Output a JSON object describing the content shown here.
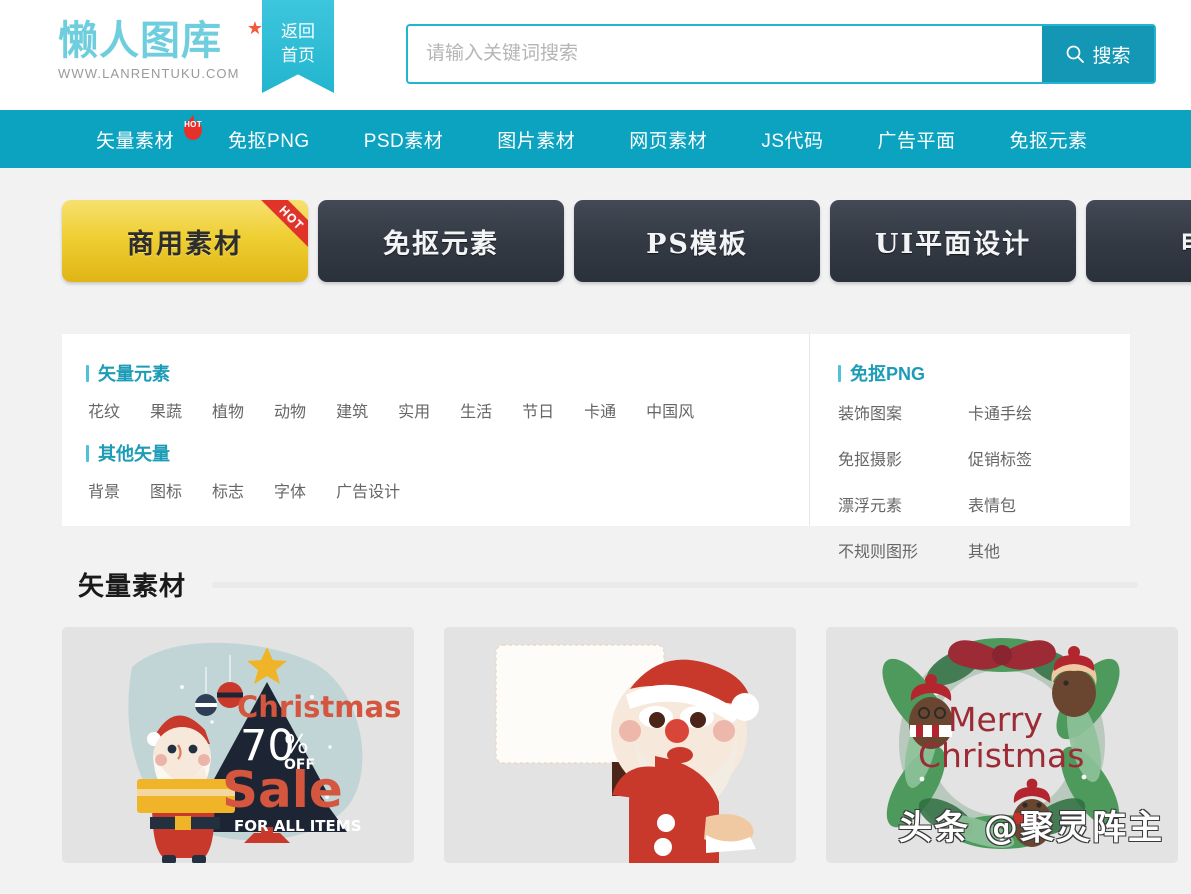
{
  "header": {
    "logo_text": "懒人图库",
    "logo_star_icon": "star-icon",
    "logo_url": "WWW.LANRENTUKU.COM",
    "home_ribbon_line1": "返回",
    "home_ribbon_line2": "首页",
    "search": {
      "placeholder": "请输入关键词搜索",
      "value": "",
      "button_label": "搜索",
      "button_icon": "search-icon",
      "accent_color": "#23b5cf",
      "button_color": "#1397b5"
    }
  },
  "nav": {
    "background_color": "#0ba3c0",
    "items": [
      {
        "label": "矢量素材",
        "badge": "HOT",
        "badge_icon": "flame-icon"
      },
      {
        "label": "免抠PNG"
      },
      {
        "label": "PSD素材"
      },
      {
        "label": "图片素材"
      },
      {
        "label": "网页素材"
      },
      {
        "label": "JS代码"
      },
      {
        "label": "广告平面"
      },
      {
        "label": "免抠元素"
      }
    ]
  },
  "category_buttons": [
    {
      "label": "商用素材",
      "style": "gold",
      "badge": "HOT"
    },
    {
      "label": "免抠元素",
      "style": "dark"
    },
    {
      "label": "PS模板",
      "style": "dark"
    },
    {
      "label": "UI平面设计",
      "style": "dark"
    },
    {
      "label": "电商",
      "style": "dark"
    }
  ],
  "panel": {
    "left_groups": [
      {
        "title": "矢量元素",
        "tags": [
          "花纹",
          "果蔬",
          "植物",
          "动物",
          "建筑",
          "实用",
          "生活",
          "节日",
          "卡通",
          "中国风"
        ]
      },
      {
        "title": "其他矢量",
        "tags": [
          "背景",
          "图标",
          "标志",
          "字体",
          "广告设计"
        ]
      }
    ],
    "right_group": {
      "title": "免抠PNG",
      "tags": [
        "装饰图案",
        "卡通手绘",
        "免抠摄影",
        "促销标签",
        "漂浮元素",
        "表情包",
        "不规则图形",
        "其他"
      ]
    },
    "accent_color": "#1c9cb6"
  },
  "section": {
    "title": "矢量素材"
  },
  "thumbnails": [
    {
      "name": "christmas-sale-santa",
      "texts": {
        "line1": "Christmas",
        "line2": "70",
        "percent": "%",
        "off": "OFF",
        "line3": "Sale",
        "line4": "FOR ALL ITEMS"
      }
    },
    {
      "name": "santa-holding-blank-sign",
      "texts": {}
    },
    {
      "name": "merry-christmas-wreath",
      "texts": {
        "line1": "Merry",
        "line2": "Christmas"
      }
    }
  ],
  "watermark": {
    "text": "头条 @聚灵阵主"
  }
}
